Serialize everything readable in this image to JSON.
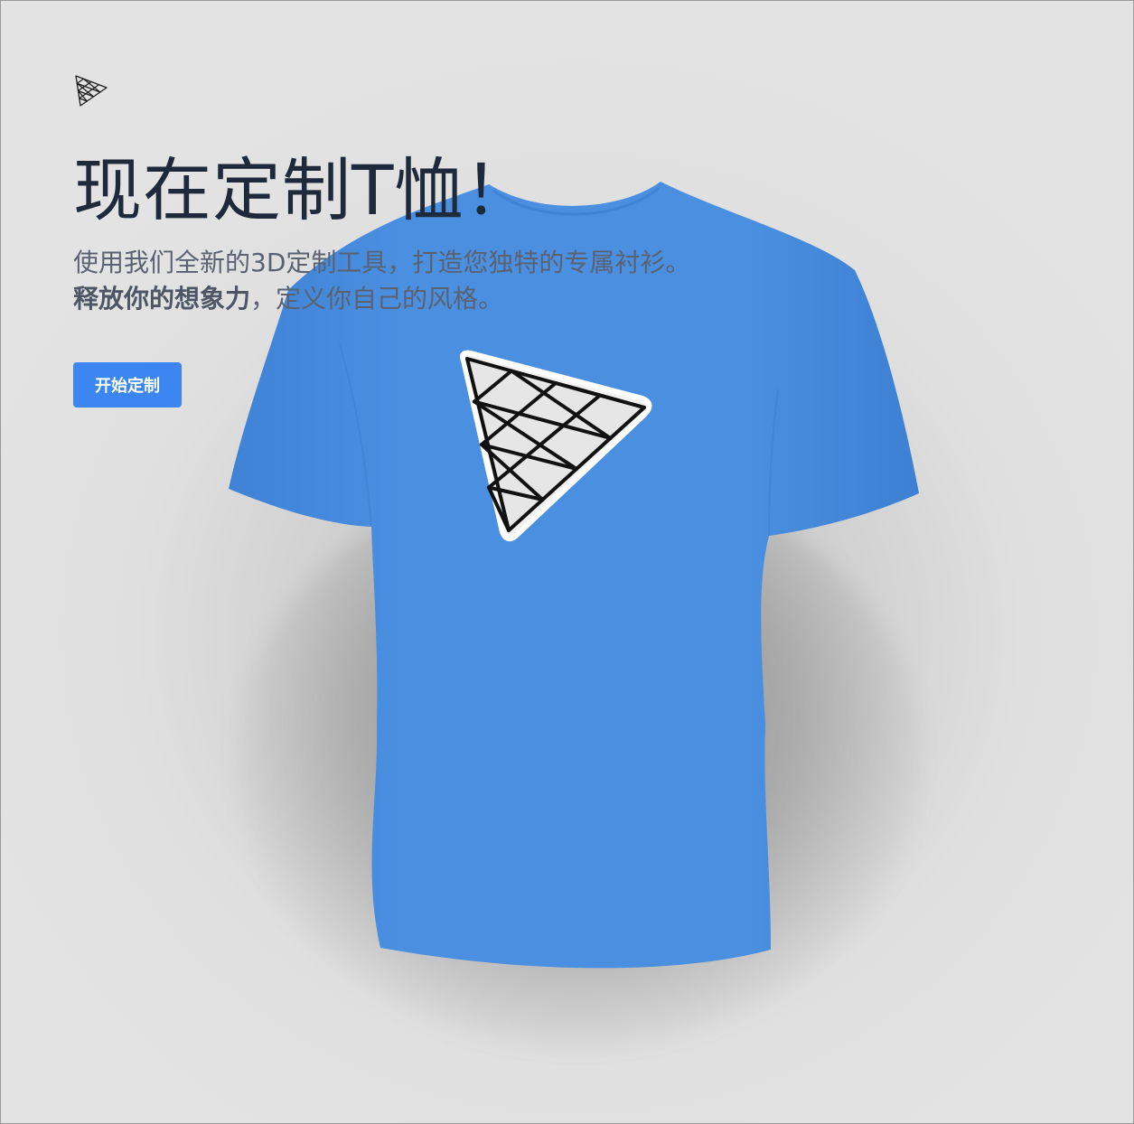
{
  "hero": {
    "title": "现在定制T恤！",
    "subtitle_line1": "使用我们全新的3D定制工具，打造您独特的专属衬衫。",
    "subtitle_line2_bold": "释放你的想象力",
    "subtitle_line2_rest": "，定义你自己的风格。",
    "cta_label": "开始定制"
  },
  "logo_icon": "triangle-mesh-icon",
  "shirt": {
    "color": "#4a8fe0",
    "decal_icon": "triangle-mesh-icon"
  },
  "colors": {
    "accent": "#3b86f0",
    "title": "#1e2a3b",
    "subtitle": "#5a6272",
    "background": "#e2e2e2"
  }
}
